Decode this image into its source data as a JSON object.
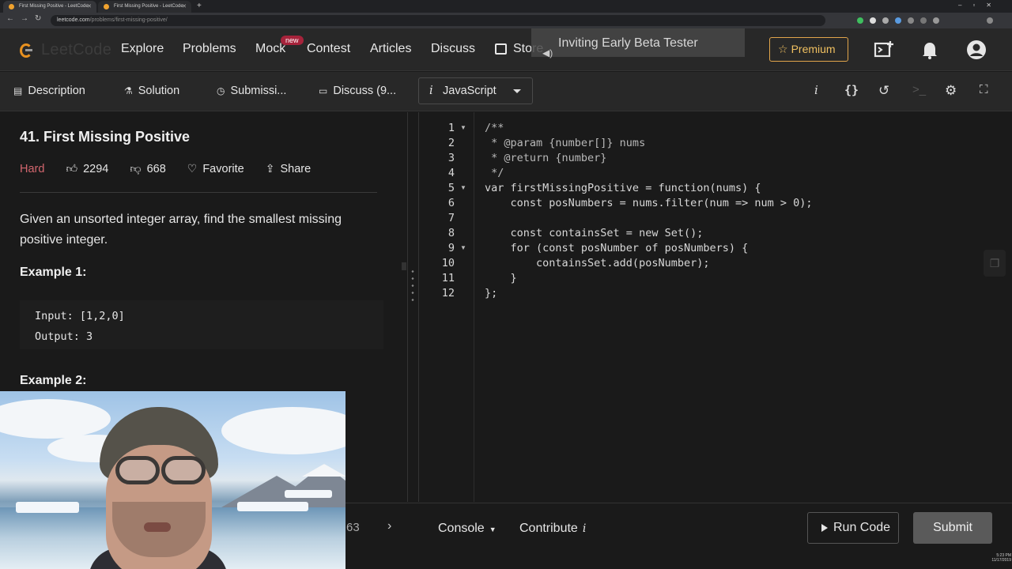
{
  "browser": {
    "tabs": [
      {
        "title": "First Missing Positive - LeetCode"
      },
      {
        "title": "First Missing Positive - LeetCode"
      }
    ],
    "new_tab": "+",
    "url_domain": "leetcode.com",
    "url_path": "/problems/first-missing-positive/"
  },
  "nav": {
    "logo_text": "LeetCode",
    "links": {
      "explore": "Explore",
      "problems": "Problems",
      "mock": "Mock",
      "mock_badge": "new",
      "contest": "Contest",
      "articles": "Articles",
      "discuss": "Discuss",
      "store": "Store"
    },
    "banner": "Inviting Early Beta Tester",
    "premium": "Premium",
    "accent": "#e1a54b"
  },
  "subbar": {
    "tabs": {
      "description": "Description",
      "solution": "Solution",
      "submissions": "Submissi...",
      "discuss": "Discuss (9..."
    },
    "language": "JavaScript"
  },
  "problem": {
    "title": "41. First Missing Positive",
    "difficulty": "Hard",
    "difficulty_color": "#d2666e",
    "likes": "2294",
    "dislikes": "668",
    "favorite": "Favorite",
    "share": "Share",
    "description": "Given an unsorted integer array, find the smallest missing positive integer.",
    "example1_heading": "Example 1:",
    "example1_input": "Input: [1,2,0]",
    "example1_output": "Output: 3",
    "example2_heading": "Example 2:"
  },
  "editor": {
    "line_numbers": [
      "1",
      "2",
      "3",
      "4",
      "5",
      "6",
      "7",
      "8",
      "9",
      "10",
      "11",
      "12"
    ],
    "lines": [
      "/**",
      " * @param {number[]} nums",
      " * @return {number}",
      " */",
      "var firstMissingPositive = function(nums) {",
      "    const posNumbers = nums.filter(num => num > 0);",
      "",
      "    const containsSet = new Set();",
      "    for (const posNumber of posNumbers) {",
      "        containsSet.add(posNumber);",
      "    }",
      "};"
    ]
  },
  "bottom": {
    "page_fragment": "63",
    "console": "Console",
    "contribute": "Contribute",
    "run_code": "Run Code",
    "submit": "Submit"
  },
  "clock": {
    "time": "5:23 PM",
    "date": "11/17/2019"
  }
}
